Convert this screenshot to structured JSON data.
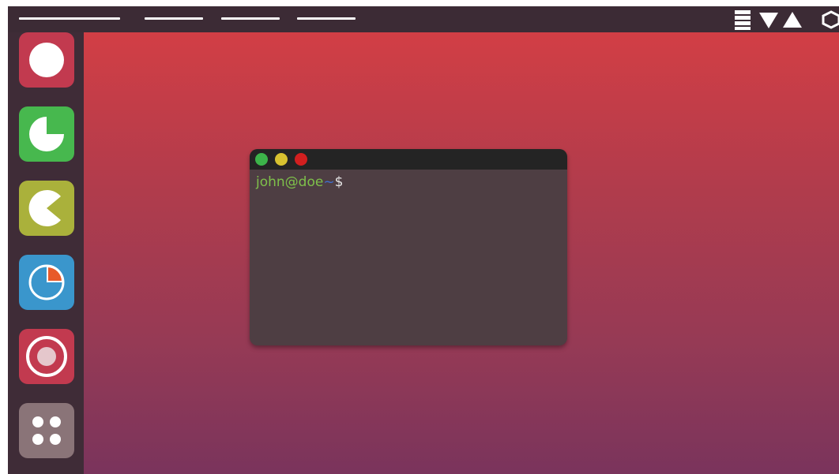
{
  "top_bar": {
    "menus": [
      "",
      "",
      "",
      ""
    ],
    "tray_icons": [
      "storage-icon",
      "volume-down-icon",
      "volume-up-icon",
      "settings-icon"
    ]
  },
  "dock": {
    "apps": [
      {
        "name": "app-white-circle",
        "icon": "circle-icon",
        "color": "#c23a4f"
      },
      {
        "name": "app-green-pie",
        "icon": "pie-three-quarter-icon",
        "color": "#47b84e"
      },
      {
        "name": "app-olive-pacman",
        "icon": "pacman-icon",
        "color": "#aab13b"
      },
      {
        "name": "app-blue-chart",
        "icon": "pie-chart-icon",
        "color": "#3a96cc"
      },
      {
        "name": "app-rings",
        "icon": "target-icon",
        "color": "#c23a4f"
      },
      {
        "name": "app-grid",
        "icon": "four-dots-icon",
        "color": "#8a7478"
      }
    ]
  },
  "terminal": {
    "buttons": [
      "close",
      "minimize",
      "maximize"
    ],
    "button_colors": [
      "#3cb44a",
      "#d8c230",
      "#d21f1f"
    ],
    "prompt_user": "john@doe",
    "prompt_path": "~",
    "prompt_sigil": "$"
  }
}
